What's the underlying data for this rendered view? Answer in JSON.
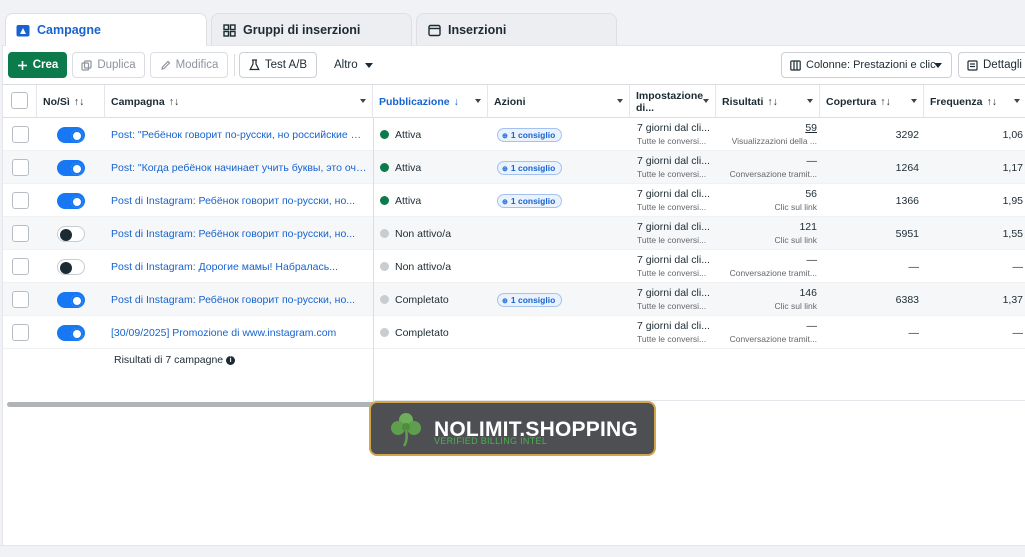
{
  "tabs": [
    {
      "label": "Campagne",
      "icon": "campaign-folder-icon"
    },
    {
      "label": "Gruppi di inserzioni",
      "icon": "grid-icon"
    },
    {
      "label": "Inserzioni",
      "icon": "ad-window-icon"
    }
  ],
  "toolbar": {
    "create_label": "Crea",
    "duplicate_label": "Duplica",
    "edit_label": "Modifica",
    "abtest_label": "Test A/B",
    "more_label": "Altro",
    "columns_label": "Colonne: Prestazioni e clic",
    "details_label": "Dettagli"
  },
  "columns": {
    "toggle": "No/Sì",
    "campaign": "Campagna",
    "publication": "Pubblicazione",
    "actions": "Azioni",
    "setting": "Impostazione di...",
    "results": "Risultati",
    "reach": "Copertura",
    "frequency": "Frequenza"
  },
  "sort_icons": {
    "updown": "↑↓",
    "down": "↓"
  },
  "rows": [
    {
      "on": true,
      "name": "Post: \"Ребёнок говорит по-русски, но российские шк...",
      "status": "Attiva",
      "status_color": "#0b7b4b",
      "badge": "1 consiglio",
      "setting": "7 giorni dal cli...",
      "setting_sub": "Tutte le conversi...",
      "result": "59",
      "result_sub": "Visualizzazioni della ...",
      "reach": "3292",
      "freq": "1,06"
    },
    {
      "on": true,
      "name": "Post: \"Когда ребёнок начинает учить буквы, это очен...",
      "status": "Attiva",
      "status_color": "#0b7b4b",
      "badge": "1 consiglio",
      "setting": "7 giorni dal cli...",
      "setting_sub": "Tutte le conversi...",
      "result": "—",
      "result_sub": "Conversazione tramit...",
      "reach": "1264",
      "freq": "1,17"
    },
    {
      "on": true,
      "name": "Post di Instagram: Ребёнок говорит по-русски, но...",
      "status": "Attiva",
      "status_color": "#0b7b4b",
      "badge": "1 consiglio",
      "setting": "7 giorni dal cli...",
      "setting_sub": "Tutte le conversi...",
      "result": "56",
      "result_sub": "Clic sul link",
      "reach": "1366",
      "freq": "1,95"
    },
    {
      "on": false,
      "name": "Post di Instagram: Ребёнок говорит по-русски, но...",
      "status": "Non attivo/a",
      "status_color": "#c9ccd1",
      "badge": "",
      "setting": "7 giorni dal cli...",
      "setting_sub": "Tutte le conversi...",
      "result": "121",
      "result_sub": "Clic sul link",
      "reach": "5951",
      "freq": "1,55"
    },
    {
      "on": false,
      "name": "Post di Instagram: Дорогие мамы! Набралась...",
      "status": "Non attivo/a",
      "status_color": "#c9ccd1",
      "badge": "",
      "setting": "7 giorni dal cli...",
      "setting_sub": "Tutte le conversi...",
      "result": "—",
      "result_sub": "Conversazione tramit...",
      "reach": "—",
      "freq": "—"
    },
    {
      "on": true,
      "name": "Post di Instagram: Ребёнок говорит по-русски, но...",
      "status": "Completato",
      "status_color": "#c9ccd1",
      "badge": "1 consiglio",
      "setting": "7 giorni dal cli...",
      "setting_sub": "Tutte le conversi...",
      "result": "146",
      "result_sub": "Clic sul link",
      "reach": "6383",
      "freq": "1,37"
    },
    {
      "on": true,
      "name": "[30/09/2025] Promozione di www.instagram.com",
      "status": "Completato",
      "status_color": "#c9ccd1",
      "badge": "",
      "setting": "7 giorni dal cli...",
      "setting_sub": "Tutte le conversi...",
      "result": "—",
      "result_sub": "Conversazione tramit...",
      "reach": "—",
      "freq": "—"
    }
  ],
  "summary": "Risultati di 7 campagne",
  "watermark": {
    "title": "NOLIMIT.SHOPPING",
    "subtitle": "VERIFIED BILLING INTEL"
  },
  "colors": {
    "brand_green": "#0b7b4b",
    "link_blue": "#1763cf",
    "toggle_blue": "#1877f2",
    "watermark_border": "#d2a64a"
  }
}
